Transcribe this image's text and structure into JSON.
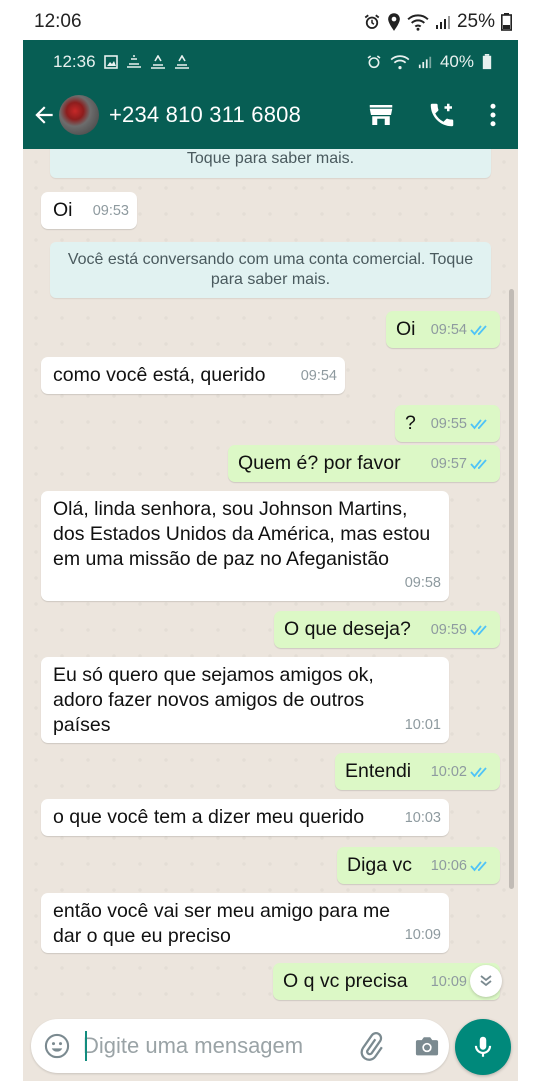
{
  "device_status": {
    "time": "12:06",
    "battery": "25%"
  },
  "app_status": {
    "time": "12:36",
    "battery": "40%"
  },
  "header": {
    "contact": "+234 810 311 6808"
  },
  "messages": [
    {
      "type": "system",
      "text": "Toque para saber mais."
    },
    {
      "type": "in",
      "text": "Oi",
      "time": "09:53"
    },
    {
      "type": "system",
      "text": "Você está conversando com uma conta comercial. Toque para saber mais."
    },
    {
      "type": "out",
      "text": "Oi",
      "time": "09:54",
      "status": "read"
    },
    {
      "type": "in",
      "text": "como você está, querido",
      "time": "09:54"
    },
    {
      "type": "out",
      "text": "?",
      "time": "09:55",
      "status": "read"
    },
    {
      "type": "out",
      "text": "Quem é?  por favor",
      "time": "09:57",
      "status": "read"
    },
    {
      "type": "in",
      "text": "Olá, linda senhora, sou Johnson Martins, dos Estados Unidos da América, mas estou em uma missão de paz no Afeganistão",
      "time": "09:58"
    },
    {
      "type": "out",
      "text": "O que deseja?",
      "time": "09:59",
      "status": "read"
    },
    {
      "type": "in",
      "text": "Eu só quero que sejamos amigos ok, adoro fazer novos amigos de outros países",
      "time": "10:01"
    },
    {
      "type": "out",
      "text": "Entendi",
      "time": "10:02",
      "status": "read"
    },
    {
      "type": "in",
      "text": "o que você tem a dizer meu querido",
      "time": "10:03"
    },
    {
      "type": "out",
      "text": "Diga vc",
      "time": "10:06",
      "status": "read"
    },
    {
      "type": "in",
      "text": "então você vai ser meu amigo para me dar o que eu preciso",
      "time": "10:09"
    },
    {
      "type": "out",
      "text": "O q vc precisa",
      "time": "10:09",
      "status": "read"
    }
  ],
  "composer": {
    "placeholder": "Digite uma mensagem"
  },
  "colors": {
    "header": "#075e54",
    "outgoing": "#dcf8c6",
    "incoming": "#ffffff",
    "read_ticks": "#4fc3f7",
    "mic": "#00897b"
  },
  "icons": [
    "back-arrow-icon",
    "store-icon",
    "add-call-icon",
    "more-vert-icon",
    "emoji-icon",
    "attach-icon",
    "camera-icon",
    "mic-icon",
    "chevron-down-icon"
  ]
}
